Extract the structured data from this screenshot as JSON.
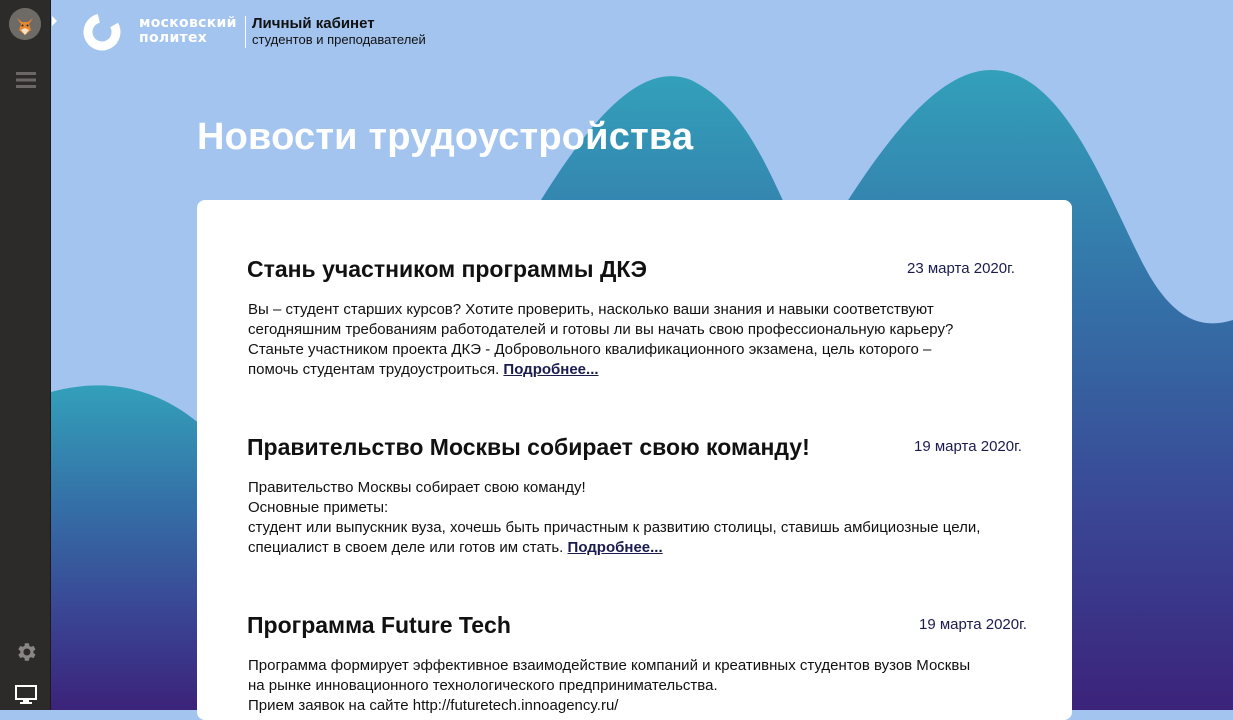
{
  "header": {
    "logo_name_line1": "московский",
    "logo_name_line2": "политех",
    "cabinet_title": "Личный кабинет",
    "cabinet_subtitle": "студентов и преподавателей"
  },
  "page": {
    "title": "Новости трудоустройства"
  },
  "sidebar": {
    "icons": [
      "avatar",
      "menu-icon",
      "gear-icon",
      "monitor-icon"
    ]
  },
  "news": [
    {
      "title": "Стань участником программы ДКЭ",
      "date": "23 марта 2020г.",
      "lines": [
        "Вы – студент старших курсов? Хотите проверить, насколько ваши знания и навыки соответствуют",
        "сегодняшним требованиям работодателей и готовы ли вы начать свою профессиональную карьеру?",
        "Станьте участником проекта ДКЭ - Добровольного квалификационного экзамена, цель которого –",
        "помочь студентам трудоустроиться."
      ],
      "more": "Подробнее..."
    },
    {
      "title": "Правительство Москвы собирает свою команду!",
      "date": "19 марта 2020г.",
      "lines": [
        "Правительство Москвы собирает свою команду!",
        "Основные приметы:",
        "студент или выпускник вуза, хочешь быть причастным к развитию столицы, ставишь амбициозные цели,",
        "специалист в своем деле или готов им стать."
      ],
      "more": "Подробнее..."
    },
    {
      "title": "Программа Future Tech",
      "date": "19 марта 2020г.",
      "lines": [
        "Программа формирует эффективное взаимодействие компаний и креативных студентов вузов Москвы",
        "на рынке инновационного технологического предпринимательства.",
        "Прием заявок на сайте http://futuretech.innoagency.ru/"
      ]
    }
  ],
  "colors": {
    "sky": "#a3c4ef",
    "sidebar": "#2d2b2a",
    "date_text": "#1a1c4e",
    "wave_top": "#33a0ba",
    "wave_bottom": "#3b237a"
  }
}
